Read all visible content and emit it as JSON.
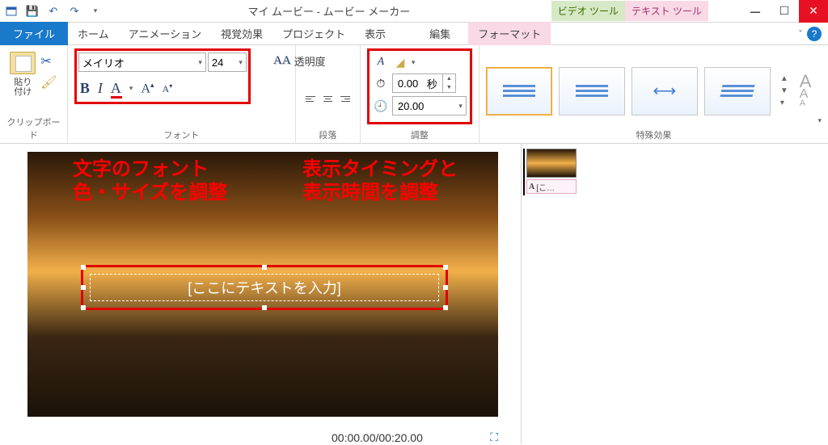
{
  "title": "マイ ムービー - ムービー メーカー",
  "tool_tabs": {
    "video": "ビデオ ツール",
    "text": "テキスト ツール"
  },
  "tabs": {
    "file": "ファイル",
    "home": "ホーム",
    "animation": "アニメーション",
    "visual": "視覚効果",
    "project": "プロジェクト",
    "view": "表示",
    "edit": "編集",
    "format": "フォーマット"
  },
  "groups": {
    "clipboard": "クリップボード",
    "font": "フォント",
    "paragraph": "段落",
    "timing": "調整",
    "effects": "特殊効果"
  },
  "clipboard": {
    "paste": "貼り\n付け"
  },
  "font": {
    "name": "メイリオ",
    "size": "24",
    "transparency": "透明度",
    "bold": "B",
    "italic": "I",
    "color": "A",
    "grow": "A",
    "shrink": "A"
  },
  "timing": {
    "start_value": "0.00",
    "start_unit": "秒",
    "duration_value": "20.00"
  },
  "annotations": {
    "font_line1": "文字のフォント",
    "font_line2": "色・サイズを調整",
    "timing_line1": "表示タイミングと",
    "timing_line2": "表示時間を調整"
  },
  "textbox_placeholder": "[ここにテキストを入力]",
  "time_readout": "00:00.00/00:20.00",
  "caption_clip": "[こ…",
  "caption_A": "A"
}
